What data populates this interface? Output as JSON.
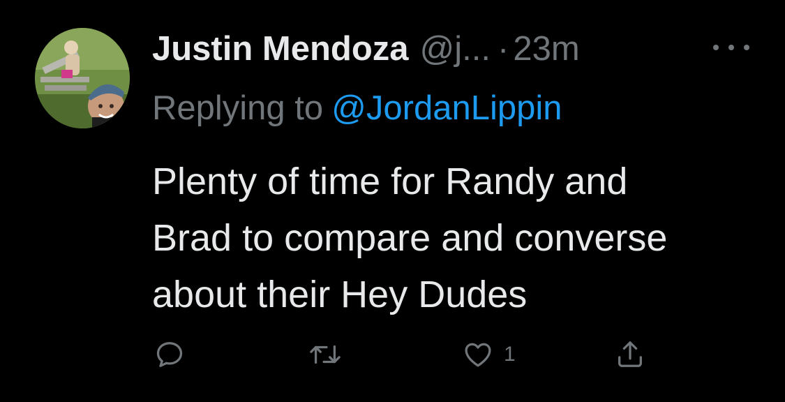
{
  "tweet": {
    "author": {
      "display_name": "Justin Mendoza",
      "handle": "@j...",
      "separator": "·",
      "timestamp": "23m"
    },
    "replying_prefix": "Replying to",
    "replying_to": "@JordanLippin",
    "body_lines": [
      "Plenty of time for Randy and",
      "Brad to compare and converse",
      "about their Hey Dudes"
    ],
    "actions": {
      "reply_icon": "reply-icon",
      "retweet_icon": "retweet-icon",
      "like_icon": "heart-icon",
      "like_count": "1",
      "share_icon": "share-icon"
    }
  },
  "colors": {
    "background": "#000000",
    "primary_text": "#e7e9ea",
    "secondary_text": "#71767b",
    "link": "#1d9bf0"
  }
}
